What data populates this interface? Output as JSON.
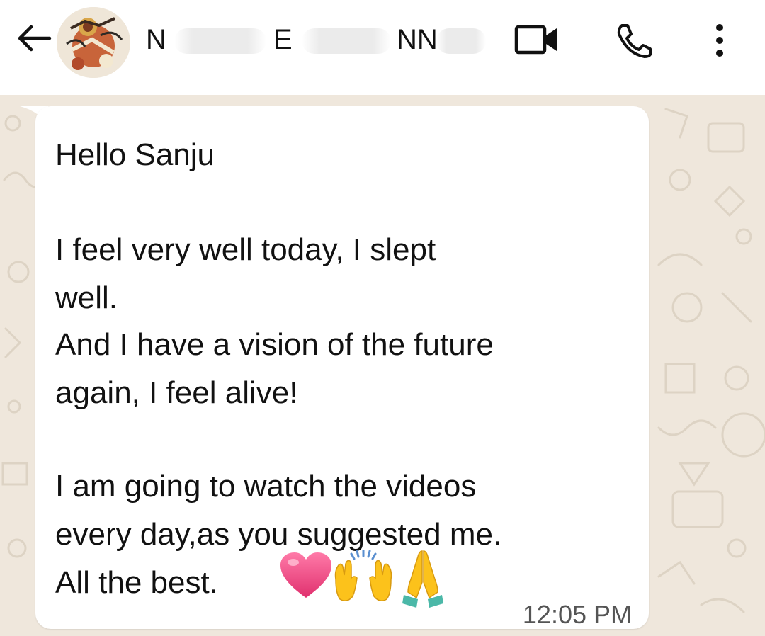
{
  "header": {
    "contact_name_parts": [
      "N",
      "E",
      "NN"
    ],
    "icons": {
      "back": "back-arrow-icon",
      "video": "video-call-icon",
      "call": "voice-call-icon",
      "menu": "more-options-icon"
    }
  },
  "message": {
    "lines": [
      "Hello Sanju",
      "",
      "I feel very well today, I slept",
      "well.",
      "And I have a vision of the future",
      "again, I feel alive!",
      "",
      "I am going to watch the videos",
      "every day,as you suggested me.",
      "All the best."
    ],
    "emojis": [
      "heart-emoji",
      "raising-hands-emoji",
      "folded-hands-emoji"
    ],
    "time": "12:05 PM"
  },
  "colors": {
    "chat_background": "#efe7dc",
    "bubble": "#ffffff",
    "header": "#ffffff",
    "text": "#111111",
    "timestamp": "#555555"
  }
}
